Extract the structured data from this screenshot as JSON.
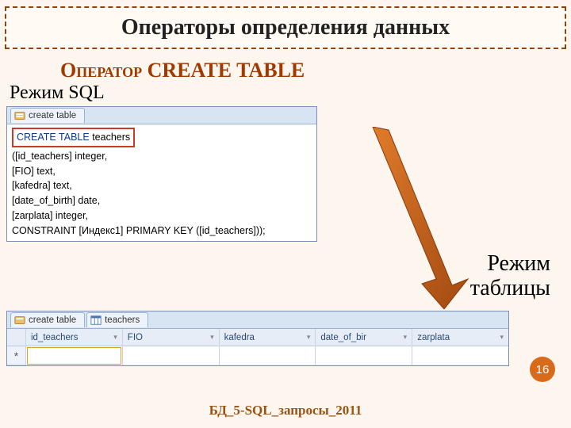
{
  "slide": {
    "title": "Операторы определения данных",
    "subtitle_op": "Оператор",
    "subtitle_cmd": "CREATE TABLE",
    "mode_sql": "Режим SQL",
    "mode_table_line1": "Режим",
    "mode_table_line2": "таблицы",
    "page_number": "16",
    "footer": "БД_5-SQL_запросы_2011"
  },
  "sql_view": {
    "tab_label": "create table",
    "code": {
      "line1_kw": "CREATE TABLE",
      "line1_rest": "teachers",
      "line2": "([id_teachers] integer,",
      "line3": "[FIO] text,",
      "line4": "[kafedra] text,",
      "line5": "[date_of_birth] date,",
      "line6": "[zarplata] integer,",
      "line7": "CONSTRAINT  [Индекс1]  PRIMARY KEY ([id_teachers]));"
    }
  },
  "table_view": {
    "tab1_label": "create table",
    "tab2_label": "teachers",
    "columns": [
      "id_teachers",
      "FIO",
      "kafedra",
      "date_of_bir",
      "zarplata"
    ],
    "new_row_marker": "*"
  }
}
